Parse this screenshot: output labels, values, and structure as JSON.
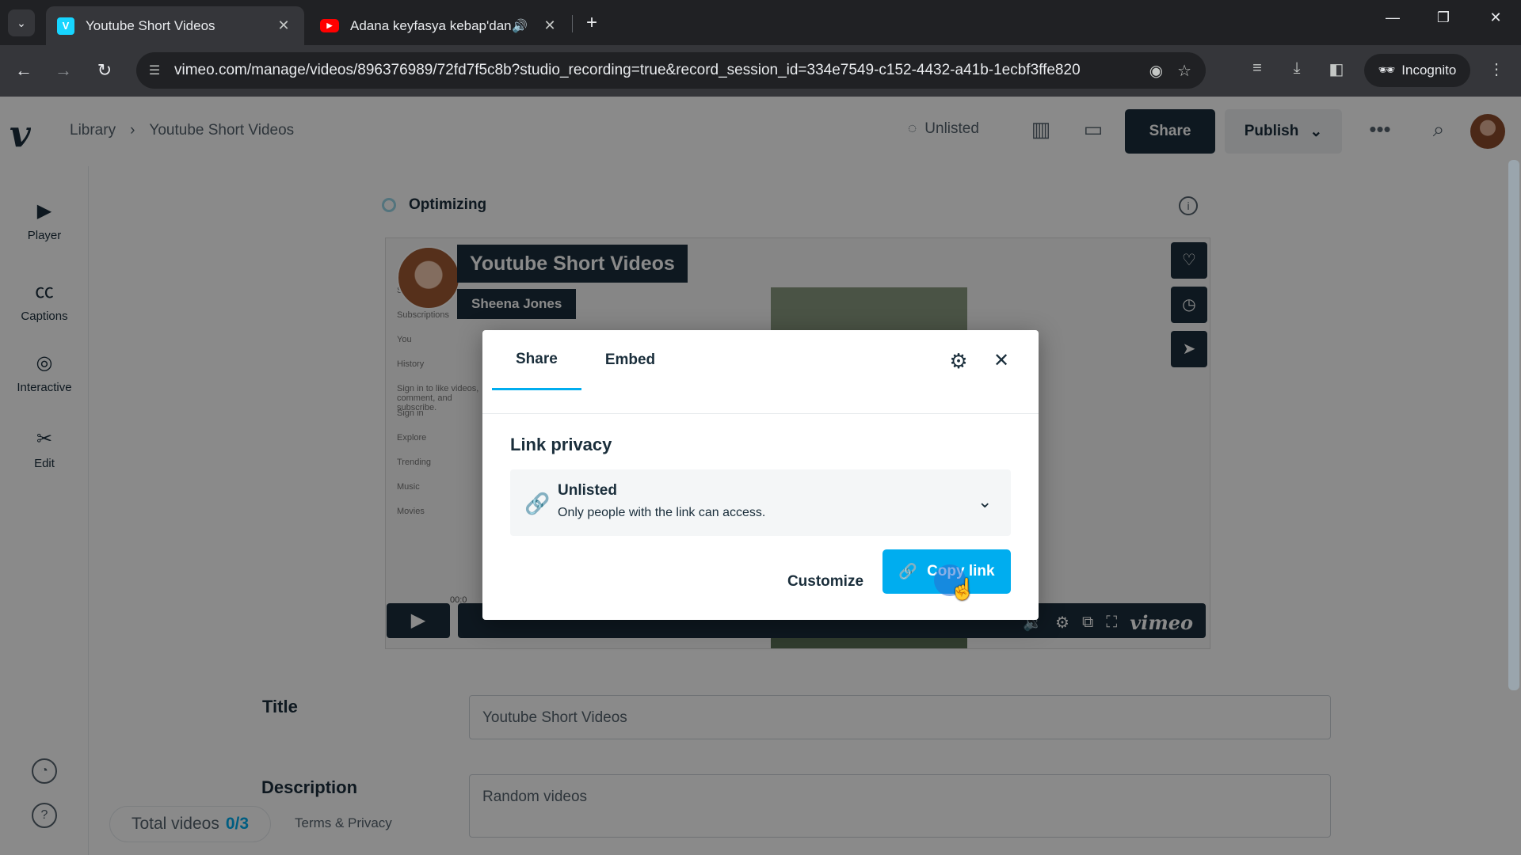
{
  "browser": {
    "tabs": [
      {
        "title": "Youtube Short Videos",
        "favicon": "vimeo-icon",
        "active": true
      },
      {
        "title": "Adana keyfasya kebap'dan ",
        "favicon": "youtube-icon",
        "active": false,
        "audio": true
      }
    ],
    "url": "vimeo.com/manage/videos/896376989/72fd7f5c8b?studio_recording=true&record_session_id=334e7549-c152-4432-a41b-1ecbf3ffe820",
    "incognito_label": "Incognito"
  },
  "app": {
    "breadcrumb": {
      "root": "Library",
      "current": "Youtube Short Videos"
    },
    "header": {
      "privacy": "Unlisted",
      "share": "Share",
      "publish": "Publish"
    },
    "sidebar": [
      {
        "label": "Player",
        "icon": "play-square-icon"
      },
      {
        "label": "Captions",
        "icon": "cc-icon"
      },
      {
        "label": "Interactive",
        "icon": "interactive-icon"
      },
      {
        "label": "Edit",
        "icon": "scissors-icon"
      }
    ],
    "status": "Optimizing",
    "video": {
      "title": "Youtube Short Videos",
      "author": "Sheena Jones",
      "time": "00:0",
      "brand": "vimeo",
      "yt_sidebar": [
        "Shorts",
        "Subscriptions",
        "You",
        "History",
        "Sign in to like videos, comment, and subscribe.",
        "Sign in",
        "Explore",
        "Trending",
        "Music",
        "Movies"
      ]
    },
    "fields": {
      "title_label": "Title",
      "title_value": "Youtube Short Videos",
      "description_label": "Description",
      "description_value": "Random videos"
    },
    "footer": {
      "total_label": "Total videos",
      "total_count": "0/3",
      "terms": "Terms & Privacy"
    }
  },
  "dialog": {
    "tabs": [
      "Share",
      "Embed"
    ],
    "section_title": "Link privacy",
    "privacy_option": {
      "title": "Unlisted",
      "description": "Only people with the link can access."
    },
    "customize": "Customize",
    "copy_link": "Copy link",
    "accent_color": "#00adef"
  }
}
